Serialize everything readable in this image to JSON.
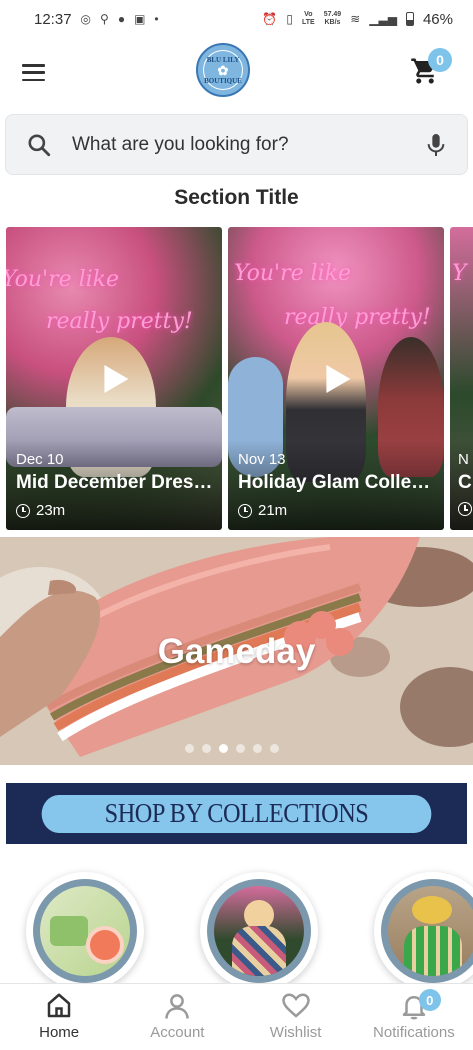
{
  "status_bar": {
    "time": "12:37",
    "network_speed_top": "57.49",
    "network_speed_unit": "KB/s",
    "volte_top": "Vo",
    "volte_bottom": "LTE",
    "battery_percent": "46%"
  },
  "header": {
    "logo_line1": "BLU LILY",
    "logo_line2": "BOUTIQUE",
    "cart_count": "0"
  },
  "search": {
    "placeholder": "What are you looking for?"
  },
  "section": {
    "title": "Section Title"
  },
  "videos": [
    {
      "date": "Dec 10",
      "title": "Mid December Dresses",
      "duration": "23m",
      "neon_line1": "You're like",
      "neon_line2": "really pretty!"
    },
    {
      "date": "Nov 13",
      "title": "Holiday Glam Collection",
      "duration": "21m",
      "neon_line1": "You're like",
      "neon_line2": "really pretty!"
    },
    {
      "date": "N",
      "title": "C",
      "duration": "",
      "neon_line1": "Y",
      "neon_line2": ""
    }
  ],
  "banner": {
    "title": "Gameday",
    "slide_count": 6,
    "active_slide": 3
  },
  "collections": {
    "banner_label": "SHOP BY COLLECTIONS"
  },
  "nav": {
    "home": "Home",
    "account": "Account",
    "wishlist": "Wishlist",
    "notifications": "Notifications",
    "notifications_count": "0"
  },
  "colors": {
    "accent": "#7ec3ea",
    "navy": "#1c2b55",
    "collections_pill": "#86c5ec"
  }
}
